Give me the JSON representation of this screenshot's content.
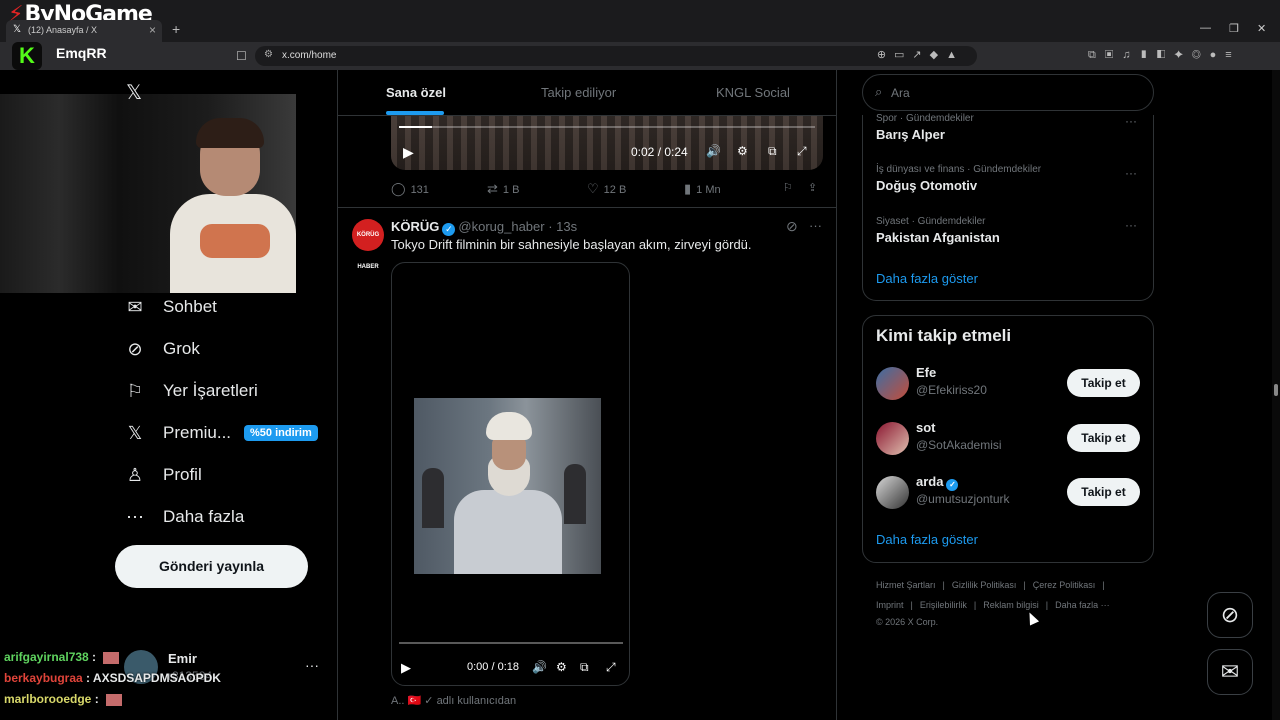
{
  "browser": {
    "brand": "ByNoGame",
    "tab_title": "(12) Anasayfa / X",
    "url": "x.com/home",
    "streamer_name": "EmqRR"
  },
  "sidebar": {
    "items": [
      {
        "label": "Sohbet",
        "icon": "mail-icon"
      },
      {
        "label": "Grok",
        "icon": "grok-icon"
      },
      {
        "label": "Yer İşaretleri",
        "icon": "bookmark-icon"
      },
      {
        "label": "Premiu...",
        "icon": "x-premium-icon"
      },
      {
        "label": "Profil",
        "icon": "person-icon"
      },
      {
        "label": "Daha fazla",
        "icon": "more-circle-icon"
      }
    ],
    "promo_badge": "%50 indirim",
    "post_button": "Gönderi yayınla",
    "account": {
      "name": "Emir",
      "handle": "r813584"
    }
  },
  "chat": [
    {
      "user": "arifgayirnal738",
      "color": "#5fd35f",
      "message": ""
    },
    {
      "user": "berkaybugraa",
      "color": "#e0443a",
      "message": "AXSDSAPDMSAOPDK"
    },
    {
      "user": "marlborooedge",
      "color": "#d8d86a",
      "message": ""
    }
  ],
  "feed": {
    "tabs": [
      "Sana özel",
      "Takip ediliyor",
      "KNGL Social"
    ],
    "active_tab": "Sana özel",
    "video1": {
      "time": "0:02 / 0:24",
      "progress": 0.08
    },
    "post1_actions": {
      "replies": "131",
      "reposts": "1 B",
      "likes": "12 B",
      "views": "1 Mn"
    },
    "post2": {
      "name": "KÖRÜG",
      "avatar_text": "KÖRÜG HABER",
      "handle": "@korug_haber",
      "time": "· 13s",
      "text": "Tokyo Drift filminin bir sahnesiyle başlayan akım, zirveyi gördü.",
      "video_time": "0:00 / 0:18"
    },
    "next_post_preview": "A..",
    "next_post_text": "adlı kullanıcıdan"
  },
  "right": {
    "search_placeholder": "Ara",
    "trends": [
      {
        "category": "Spor · Gündemdekiler",
        "title": "Barış Alper"
      },
      {
        "category": "İş dünyası ve finans · Gündemdekiler",
        "title": "Doğuş Otomotiv"
      },
      {
        "category": "Siyaset · Gündemdekiler",
        "title": "Pakistan Afganistan"
      }
    ],
    "show_more": "Daha fazla göster",
    "who_to_follow_title": "Kimi takip etmeli",
    "suggestions": [
      {
        "name": "Efe",
        "handle": "@Efekiriss20",
        "verified": false,
        "follow": "Takip et"
      },
      {
        "name": "sot",
        "handle": "@SotAkademisi",
        "verified": false,
        "follow": "Takip et"
      },
      {
        "name": "arda",
        "handle": "@umutsuzjonturk",
        "verified": true,
        "follow": "Takip et"
      }
    ],
    "footer_links": [
      "Hizmet Şartları",
      "Gizlilik Politikası",
      "Çerez Politikası",
      "Imprint",
      "Erişilebilirlik",
      "Reklam bilgisi",
      "Daha fazla ···"
    ],
    "copyright": "© 2026 X Corp."
  }
}
